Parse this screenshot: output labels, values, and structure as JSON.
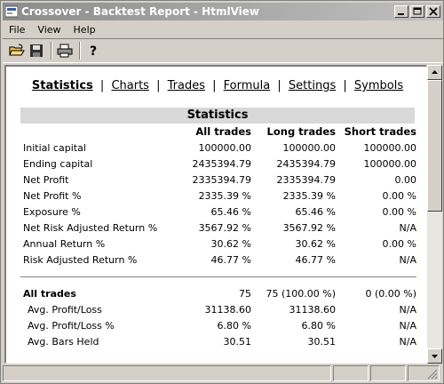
{
  "window": {
    "title": "Crossover - Backtest Report - HtmlView"
  },
  "menu": [
    "File",
    "View",
    "Help"
  ],
  "toolbar": {
    "buttons": [
      "open-folder-icon",
      "save-icon",
      "print-icon",
      "help-icon"
    ]
  },
  "nav": {
    "links": [
      "Statistics",
      "Charts",
      "Trades",
      "Formula",
      "Settings",
      "Symbols"
    ],
    "separator": "|",
    "active": "Statistics"
  },
  "section": {
    "title": "Statistics"
  },
  "table": {
    "headers": [
      "",
      "All trades",
      "Long trades",
      "Short trades"
    ],
    "rows": [
      [
        "Initial capital",
        "100000.00",
        "100000.00",
        "100000.00"
      ],
      [
        "Ending capital",
        "2435394.79",
        "2435394.79",
        "100000.00"
      ],
      [
        "Net Profit",
        "2335394.79",
        "2335394.79",
        "0.00"
      ],
      [
        "Net Profit %",
        "2335.39 %",
        "2335.39 %",
        "0.00 %"
      ],
      [
        "Exposure %",
        "65.46 %",
        "65.46 %",
        "0.00 %"
      ],
      [
        "Net Risk Adjusted Return %",
        "3567.92 %",
        "3567.92 %",
        "N/A"
      ],
      [
        "Annual Return %",
        "30.62 %",
        "30.62 %",
        "0.00 %"
      ],
      [
        "Risk Adjusted Return %",
        "46.77 %",
        "46.77 %",
        "N/A"
      ]
    ],
    "all_trades_row": [
      "All trades",
      "75",
      "75 (100.00 %)",
      "0 (0.00 %)"
    ],
    "sub_rows": [
      [
        "Avg. Profit/Loss",
        "31138.60",
        "31138.60",
        "N/A"
      ],
      [
        "Avg. Profit/Loss %",
        "6.80 %",
        "6.80 %",
        "N/A"
      ],
      [
        "Avg. Bars Held",
        "30.51",
        "30.51",
        "N/A"
      ]
    ]
  }
}
